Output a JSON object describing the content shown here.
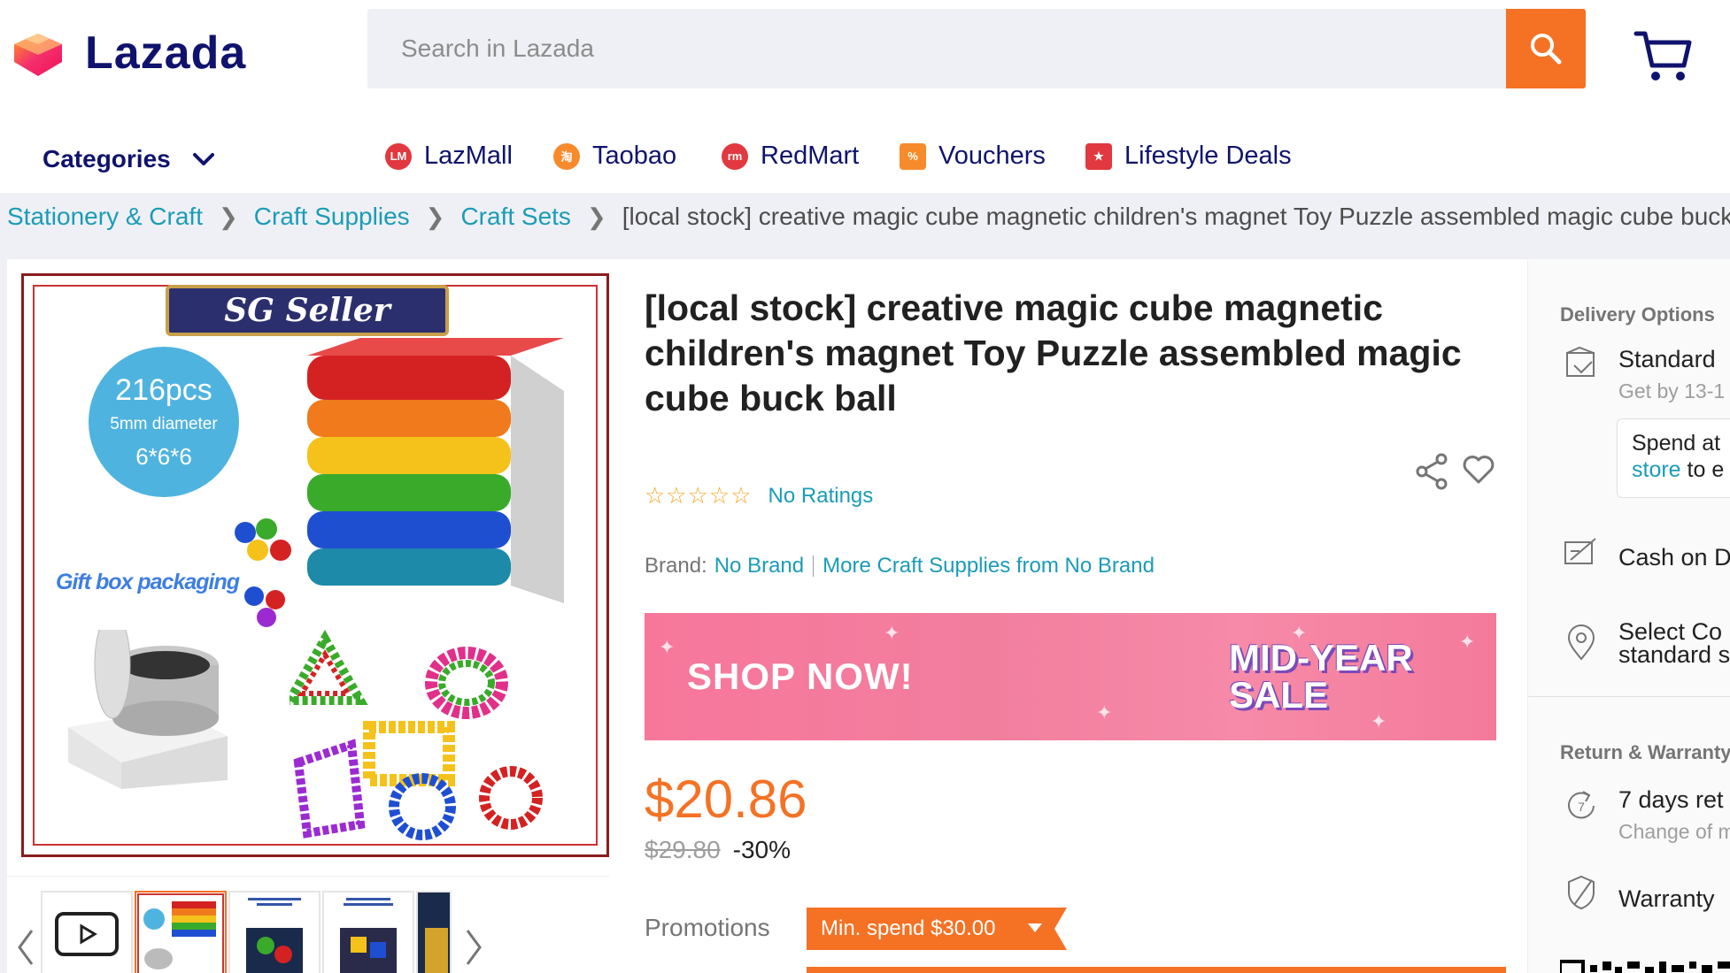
{
  "header": {
    "logo_text": "Lazada",
    "search_placeholder": "Search in Lazada"
  },
  "nav": {
    "categories_label": "Categories",
    "items": [
      {
        "label": "LazMall",
        "icon": "lazmall-icon",
        "color": "#e2383f"
      },
      {
        "label": "Taobao",
        "icon": "taobao-icon",
        "color": "#f78b2c"
      },
      {
        "label": "RedMart",
        "icon": "redmart-icon",
        "color": "#e2383f"
      },
      {
        "label": "Vouchers",
        "icon": "vouchers-icon",
        "color": "#f78b2c"
      },
      {
        "label": "Lifestyle Deals",
        "icon": "lifestyle-deals-icon",
        "color": "#e2383f"
      }
    ]
  },
  "breadcrumb": {
    "links": [
      "Stationery & Craft",
      "Craft Supplies",
      "Craft Sets"
    ],
    "current": "[local stock] creative magic cube magnetic children's magnet Toy Puzzle assembled magic cube buck ball"
  },
  "gallery": {
    "banner_text": "SG Seller",
    "spec_count": "216pcs",
    "spec_diameter": "5mm diameter",
    "spec_size": "6*6*6",
    "gift_text": "Gift box packaging"
  },
  "product": {
    "title": "[local stock] creative magic cube magnetic children's magnet Toy Puzzle assembled magic cube buck ball",
    "stars": "☆☆☆☆☆",
    "ratings_text": "No Ratings",
    "brand_label": "Brand:",
    "brand_value": "No Brand",
    "more_from": "More Craft Supplies from No Brand",
    "banner_left": "SHOP NOW!",
    "banner_right_1": "MID-YEAR",
    "banner_right_2": "SALE",
    "price": "$20.86",
    "original_price": "$29.80",
    "discount": "-30%",
    "promotions_label": "Promotions",
    "voucher_text": "Min. spend $30.00"
  },
  "side": {
    "delivery_heading": "Delivery Options",
    "standard_title": "Standard",
    "standard_sub": "Get by 13-1",
    "spend_line1": "Spend at",
    "spend_link": "store",
    "spend_rest": "to e",
    "cod": "Cash on D",
    "select_line1": "Select Co",
    "select_line2": "standard s",
    "return_heading": "Return & Warranty",
    "return_title": "7 days ret",
    "return_sub": "Change of m",
    "warranty": "Warranty"
  },
  "colors": {
    "accent": "#f57224",
    "link": "#1a9cb7",
    "brand_navy": "#0f136d"
  }
}
